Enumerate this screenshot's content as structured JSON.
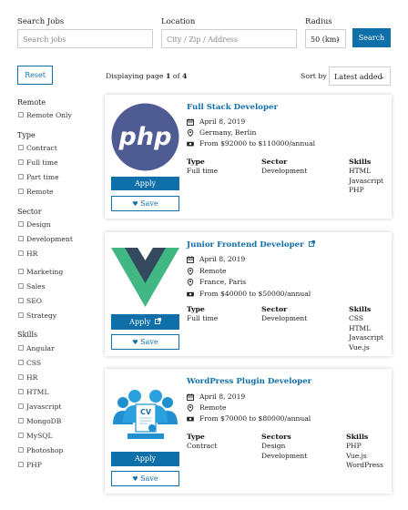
{
  "search": {
    "jobs_label": "Search Jobs",
    "jobs_placeholder": "Search jobs",
    "location_label": "Location",
    "location_placeholder": "City / Zip / Address",
    "radius_label": "Radius",
    "radius_value": "50 (km)",
    "search_button": "Search"
  },
  "toolbar": {
    "reset_button": "Reset",
    "page_prefix": "Displaying page",
    "page_current": "1",
    "page_of": "of",
    "page_total": "4",
    "sort_label": "Sort by",
    "sort_value": "Latest added"
  },
  "filters": {
    "remote": {
      "title": "Remote",
      "items": [
        "Remote Only"
      ]
    },
    "type": {
      "title": "Type",
      "items": [
        "Contract",
        "Full time",
        "Part time",
        "Remote"
      ]
    },
    "sector": {
      "title": "Sector",
      "items": [
        "Design",
        "Development",
        "HR",
        "Marketing",
        "Sales",
        "SEO",
        "Strategy"
      ]
    },
    "skills": {
      "title": "Skills",
      "items": [
        "Angular",
        "CSS",
        "HR",
        "HTML",
        "Javascript",
        "MongoDB",
        "MySQL",
        "Photoshop",
        "PHP"
      ]
    }
  },
  "jobs": [
    {
      "title": "Full Stack Developer",
      "logo_icon": "php-logo",
      "logo_text": "php",
      "date": "April 8, 2019",
      "location": "Germany, Berlin",
      "salary": "From $92000 to $110000/annual",
      "type_label": "Type",
      "type_values": [
        "Full time"
      ],
      "sector_label": "Sector",
      "sector_values": [
        "Development"
      ],
      "skills_label": "Skills",
      "skills_values": [
        "HTML",
        "Javascript",
        "PHP"
      ],
      "apply_label": "Apply",
      "save_label": "Save"
    },
    {
      "title": "Junior Frontend Developer",
      "logo_icon": "vue-logo",
      "date": "April 8, 2019",
      "location": "Remote",
      "location2": "France, Paris",
      "salary": "From $40000 to $50000/annual",
      "type_label": "Type",
      "type_values": [
        "Full time"
      ],
      "sector_label": "Sector",
      "sector_values": [
        "Development"
      ],
      "skills_label": "Skills",
      "skills_values": [
        "CSS",
        "HTML",
        "Javascript",
        "Vue.js"
      ],
      "apply_label": "Apply",
      "save_label": "Save"
    },
    {
      "title": "WordPress Plugin Developer",
      "logo_icon": "cv-team-logo",
      "logo_text": "CV",
      "date": "April 8, 2019",
      "location": "Remote",
      "salary": "From $70000 to $80000/annual",
      "type_label": "Type",
      "type_values": [
        "Contract"
      ],
      "sector_label": "Sectors",
      "sector_values": [
        "Design",
        "Development"
      ],
      "skills_label": "Skills",
      "skills_values": [
        "PHP",
        "Vue.js",
        "WordPress"
      ],
      "apply_label": "Apply",
      "save_label": "Save"
    }
  ],
  "colors": {
    "primary": "#0f6fa8",
    "php_purple": "#4f5b93",
    "vue_green": "#41b883",
    "vue_dark": "#35495e"
  }
}
